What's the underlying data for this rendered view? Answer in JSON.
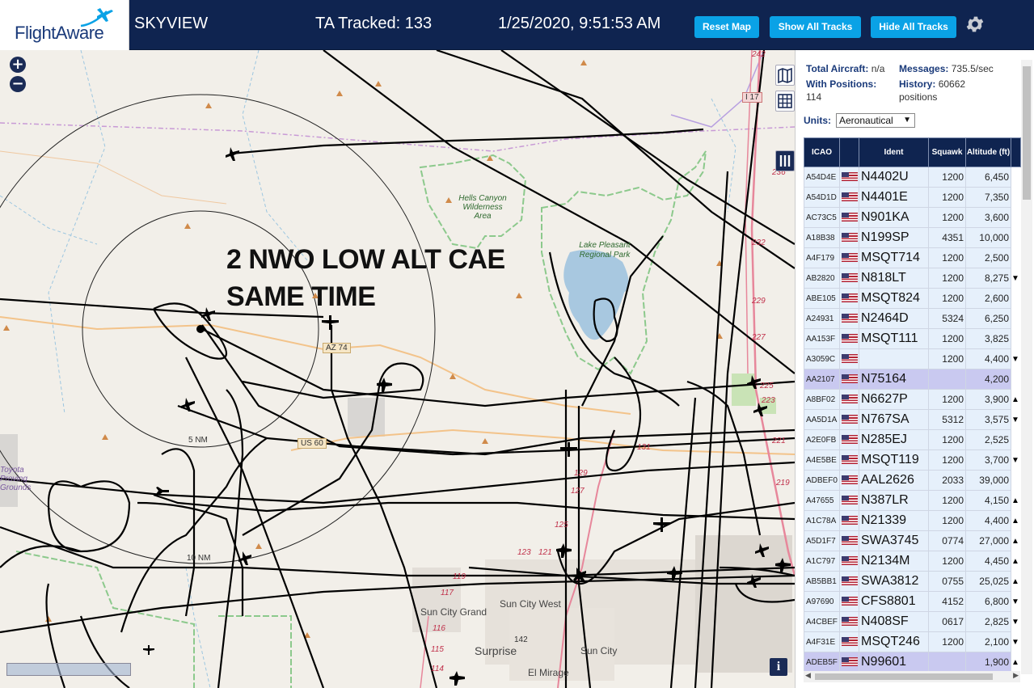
{
  "header": {
    "logo": "FlightAware",
    "title": "SKYVIEW",
    "tracked": "TA Tracked: 133",
    "clock": "1/25/2020, 9:51:53 AM",
    "reset_label": "Reset Map",
    "show_label": "Show All Tracks",
    "hide_label": "Hide All Tracks"
  },
  "map": {
    "annotation_line1": "2 NWO LOW ALT CAE",
    "annotation_line2": "SAME TIME",
    "labels": {
      "hells_canyon": "Hells Canyon Wilderness Area",
      "lake_pleasant": "Lake Pleasant Regional Park",
      "az74": "AZ 74",
      "us60": "US 60",
      "i17": "I 17",
      "ring5": "5 NM",
      "ring10": "10 NM",
      "sun_city_grand": "Sun City Grand",
      "sun_city_west": "Sun City West",
      "surprise": "Surprise",
      "sun_city": "Sun City",
      "el_mirage": "El Mirage",
      "toyota": "Toyota Proving Grounds",
      "rt242": "242",
      "rt236": "236",
      "rt232": "232",
      "rt229": "229",
      "rt227": "227",
      "rt225": "225",
      "rt223": "223",
      "rt221": "221",
      "rt219": "219",
      "rt131": "131",
      "rt129": "129",
      "rt127": "127",
      "rt125": "125",
      "rt123": "123",
      "rt121": "121",
      "rt119": "119",
      "rt117": "117",
      "rt116": "116",
      "rt115": "115",
      "rt114": "114",
      "rt142": "142"
    },
    "info_label": "i"
  },
  "stats": {
    "total_label": "Total Aircraft:",
    "total_value": "n/a",
    "messages_label": "Messages:",
    "messages_value": "735.5/sec",
    "positions_label": "With Positions:",
    "positions_value": "114",
    "history_label": "History:",
    "history_value": "60662",
    "history_unit": "positions"
  },
  "units": {
    "label": "Units:",
    "selected": "Aeronautical"
  },
  "table": {
    "columns": {
      "icao": "ICAO",
      "flag": "",
      "ident": "Ident",
      "squawk": "Squawk",
      "altitude": "Altitude (ft)"
    },
    "rows": [
      {
        "icao": "A54D4E",
        "ident": "N4402U",
        "squawk": "1200",
        "alt": "6,450",
        "trend": ""
      },
      {
        "icao": "A54D1D",
        "ident": "N4401E",
        "squawk": "1200",
        "alt": "7,350",
        "trend": ""
      },
      {
        "icao": "AC73C5",
        "ident": "N901KA",
        "squawk": "1200",
        "alt": "3,600",
        "trend": ""
      },
      {
        "icao": "A18B38",
        "ident": "N199SP",
        "squawk": "4351",
        "alt": "10,000",
        "trend": ""
      },
      {
        "icao": "A4F179",
        "ident": "MSQT714",
        "squawk": "1200",
        "alt": "2,500",
        "trend": ""
      },
      {
        "icao": "AB2820",
        "ident": "N818LT",
        "squawk": "1200",
        "alt": "8,275",
        "trend": "▼"
      },
      {
        "icao": "ABE105",
        "ident": "MSQT824",
        "squawk": "1200",
        "alt": "2,600",
        "trend": ""
      },
      {
        "icao": "A24931",
        "ident": "N2464D",
        "squawk": "5324",
        "alt": "6,250",
        "trend": ""
      },
      {
        "icao": "AA153F",
        "ident": "MSQT111",
        "squawk": "1200",
        "alt": "3,825",
        "trend": ""
      },
      {
        "icao": "A3059C",
        "ident": "",
        "squawk": "1200",
        "alt": "4,400",
        "trend": "▼"
      },
      {
        "icao": "AA2107",
        "ident": "N75164",
        "squawk": "",
        "alt": "4,200",
        "trend": ""
      },
      {
        "icao": "A8BF02",
        "ident": "N6627P",
        "squawk": "1200",
        "alt": "3,900",
        "trend": "▲"
      },
      {
        "icao": "AA5D1A",
        "ident": "N767SA",
        "squawk": "5312",
        "alt": "3,575",
        "trend": "▼"
      },
      {
        "icao": "A2E0FB",
        "ident": "N285EJ",
        "squawk": "1200",
        "alt": "2,525",
        "trend": ""
      },
      {
        "icao": "A4E5BE",
        "ident": "MSQT119",
        "squawk": "1200",
        "alt": "3,700",
        "trend": "▼"
      },
      {
        "icao": "ADBEF0",
        "ident": "AAL2626",
        "squawk": "2033",
        "alt": "39,000",
        "trend": ""
      },
      {
        "icao": "A47655",
        "ident": "N387LR",
        "squawk": "1200",
        "alt": "4,150",
        "trend": "▲"
      },
      {
        "icao": "A1C78A",
        "ident": "N21339",
        "squawk": "1200",
        "alt": "4,400",
        "trend": "▲"
      },
      {
        "icao": "A5D1F7",
        "ident": "SWA3745",
        "squawk": "0774",
        "alt": "27,000",
        "trend": "▲"
      },
      {
        "icao": "A1C797",
        "ident": "N2134M",
        "squawk": "1200",
        "alt": "4,450",
        "trend": "▲"
      },
      {
        "icao": "AB5BB1",
        "ident": "SWA3812",
        "squawk": "0755",
        "alt": "25,025",
        "trend": "▲"
      },
      {
        "icao": "A97690",
        "ident": "CFS8801",
        "squawk": "4152",
        "alt": "6,800",
        "trend": "▼"
      },
      {
        "icao": "A4CBEF",
        "ident": "N408SF",
        "squawk": "0617",
        "alt": "2,825",
        "trend": "▼"
      },
      {
        "icao": "A4F31E",
        "ident": "MSQT246",
        "squawk": "1200",
        "alt": "2,100",
        "trend": "▼"
      },
      {
        "icao": "ADEB5F",
        "ident": "N99601",
        "squawk": "",
        "alt": "1,900",
        "trend": "▲"
      }
    ],
    "selected_rows": [
      10,
      24
    ]
  },
  "colors": {
    "header_bg": "#0f2450",
    "button_bg": "#0aa2e6",
    "map_bg": "#f2efe9",
    "track": "#000000"
  }
}
